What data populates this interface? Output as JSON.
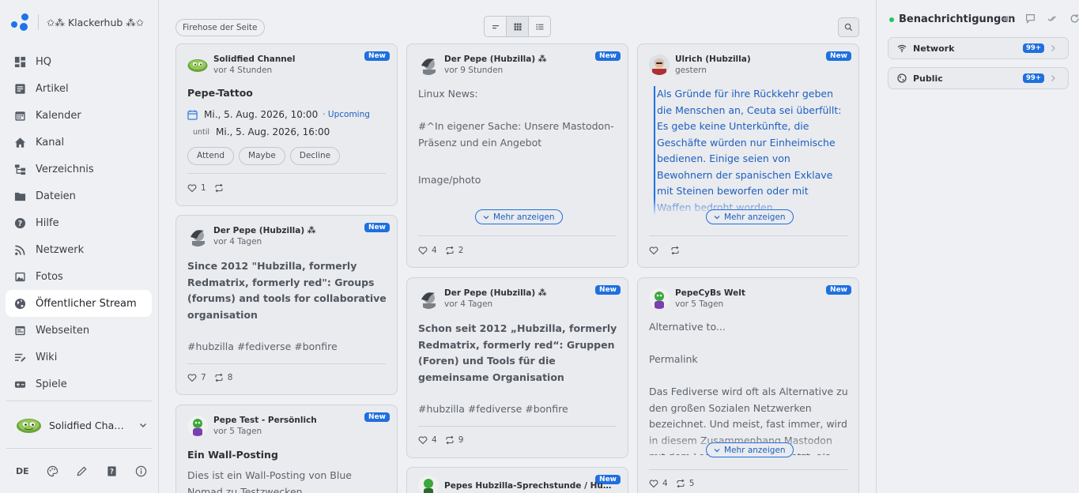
{
  "brand": {
    "name": "✩⁂ Klackerhub ⁂✩"
  },
  "sidebar": {
    "items": [
      {
        "label": "HQ",
        "icon": "hq-icon"
      },
      {
        "label": "Artikel",
        "icon": "article-icon"
      },
      {
        "label": "Kalender",
        "icon": "calendar-icon"
      },
      {
        "label": "Kanal",
        "icon": "home-icon"
      },
      {
        "label": "Verzeichnis",
        "icon": "directory-icon"
      },
      {
        "label": "Dateien",
        "icon": "folder-icon"
      },
      {
        "label": "Hilfe",
        "icon": "help-icon"
      },
      {
        "label": "Netzwerk",
        "icon": "rss-icon"
      },
      {
        "label": "Fotos",
        "icon": "image-icon"
      },
      {
        "label": "Öffentlicher Stream",
        "icon": "globe-icon",
        "active": true
      },
      {
        "label": "Webseiten",
        "icon": "website-icon"
      },
      {
        "label": "Wiki",
        "icon": "wiki-icon"
      },
      {
        "label": "Spiele",
        "icon": "gamepad-icon"
      }
    ],
    "channel": {
      "label": "Solidfied Channel"
    },
    "footer": {
      "lang": "DE"
    }
  },
  "toolbar": {
    "filter_label": "Firehose der Seite"
  },
  "cards": {
    "c1": {
      "author": "Solidfied Channel",
      "time": "vor 4 Stunden",
      "badge": "New",
      "title": "Pepe-Tattoo",
      "event_start": "Mi., 5. Aug. 2026, 10:00",
      "upcoming": "· Upcoming",
      "until": "until",
      "event_end": "Mi., 5. Aug. 2026, 16:00",
      "rsvp": [
        "Attend",
        "Maybe",
        "Decline"
      ],
      "likes": "1",
      "reshares": ""
    },
    "c2": {
      "author": "Der Pepe (Hubzilla) ⁂",
      "time": "vor 4 Tagen",
      "badge": "New",
      "body": "Since 2012 \"Hubzilla, formerly Redmatrix, formerly red\": Groups (forums) and tools for collaborative organisation",
      "tags": "#hubzilla #fediverse #bonfire",
      "likes": "7",
      "reshares": "8"
    },
    "c3": {
      "author": "Pepe Test - Persönlich",
      "time": "vor 5 Tagen",
      "badge": "New",
      "title": "Ein Wall-Posting",
      "body": "Dies ist ein Wall-Posting von Blue Nomad zu Testzwecken"
    },
    "c4": {
      "author": "Der Pepe (Hubzilla) ⁂",
      "time": "vor 9 Stunden",
      "badge": "New",
      "line1": "Linux News:",
      "line2": "#^In eigener Sache: Unsere Mastodon-Präsenz und ein Angebot",
      "line3": "Image/photo",
      "more": "Mehr anzeigen",
      "likes": "4",
      "reshares": "2"
    },
    "c5": {
      "author": "Der Pepe (Hubzilla) ⁂",
      "time": "vor 4 Tagen",
      "badge": "New",
      "body": "Schon seit 2012 „Hubzilla, formerly Redmatrix, formerly red“: Gruppen (Foren) und Tools für die gemeinsame Organisation",
      "tags": "#hubzilla #fediverse #bonfire",
      "likes": "4",
      "reshares": "9"
    },
    "c6": {
      "author": "Pepes Hubzilla-Sprechstunde / Hubzilla...",
      "badge": "New"
    },
    "c7": {
      "author": "Ulrich (Hubzilla)",
      "time": "gestern",
      "badge": "New",
      "quote": "Als Gründe für ihre Rückkehr geben die Menschen an, Ceuta sei überfüllt: Es gebe keine Unterkünfte, die Geschäfte würden nur Einheimische bedienen. Einige seien von Bewohnern der spanischen Exklave mit Steinen beworfen oder mit Waffen bedroht worden.",
      "more": "Mehr anzeigen",
      "likes": "",
      "reshares": ""
    },
    "c8": {
      "author": "PepeCyBs Welt",
      "time": "vor 5 Tagen",
      "badge": "New",
      "line1": "Alternative to...",
      "line2": "Permalink",
      "line3": "Das Fediverse wird oft als Alternative zu den großen Sozialen Netzwerken bezeichnet. Und meist, fast immer, wird in diesem Zusammenhang Mastodon mit dem Fediverse gleichgesetzt, als",
      "more": "Mehr anzeigen",
      "likes": "4",
      "reshares": "5"
    }
  },
  "notifications": {
    "title": "Benachrichtigungen",
    "items": [
      {
        "label": "Network",
        "count": "99+",
        "icon": "wifi-icon"
      },
      {
        "label": "Public",
        "count": "99+",
        "icon": "globe-icon"
      }
    ]
  },
  "colors": {
    "accent": "#1f6fde",
    "background": "#eef0f3",
    "card": "#e9ebef",
    "online": "#22c55e"
  }
}
